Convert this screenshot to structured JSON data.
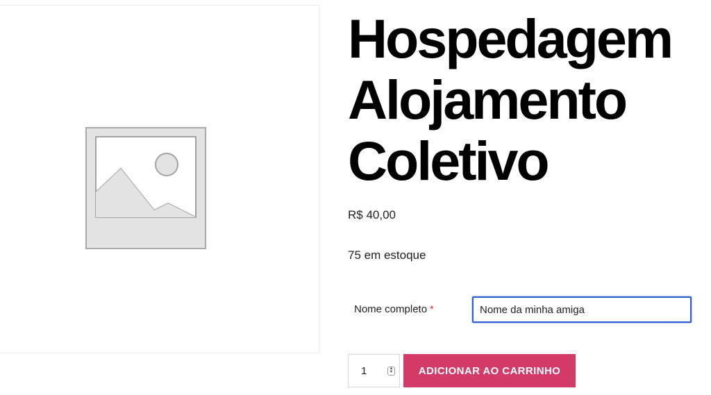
{
  "product": {
    "title_lines": [
      "Hospedagem",
      "Alojamento",
      "Coletivo"
    ],
    "price": "R$ 40,00",
    "stock": "75 em estoque"
  },
  "form": {
    "name_label": "Nome completo",
    "required_mark": "*",
    "name_value": "Nome da minha amiga"
  },
  "cart": {
    "quantity": "1",
    "add_button_label": "ADICIONAR AO CARRINHO"
  },
  "icons": {
    "product_image": "image-placeholder-icon",
    "stepper": "up-down-stepper-icon"
  },
  "colors": {
    "button": "#d33a67",
    "required": "#d63638",
    "input_focus": "#2f5fcf"
  }
}
